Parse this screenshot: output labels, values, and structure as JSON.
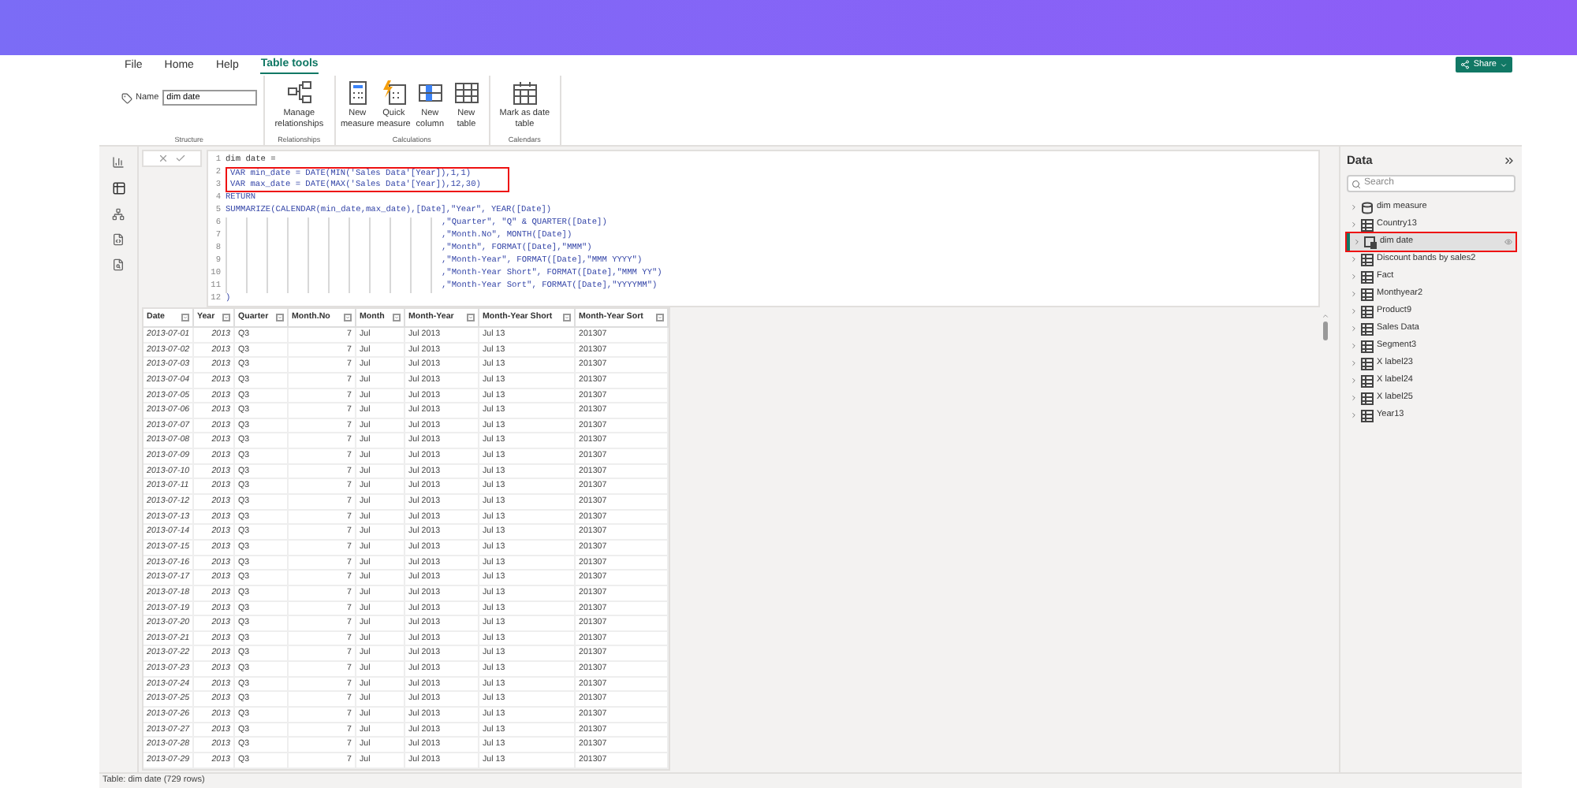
{
  "ribbon": {
    "tabs": [
      {
        "label": "File",
        "selected": false
      },
      {
        "label": "Home",
        "selected": false
      },
      {
        "label": "Help",
        "selected": false
      },
      {
        "label": "Table tools",
        "selected": true
      }
    ],
    "share": "Share",
    "name_label": "Name",
    "name_value": "dim date",
    "groups": [
      {
        "title": "Structure"
      },
      {
        "title": "Relationships",
        "buttons": [
          {
            "label": "Manage relationships",
            "kind": "relationships"
          }
        ]
      },
      {
        "title": "Calculations",
        "buttons": [
          {
            "label": "New measure",
            "kind": "measure"
          },
          {
            "label": "Quick measure",
            "kind": "quick"
          },
          {
            "label": "New column",
            "kind": "column"
          },
          {
            "label": "New table",
            "kind": "table"
          }
        ]
      },
      {
        "title": "Calendars",
        "buttons": [
          {
            "label": "Mark as date table",
            "kind": "calendar"
          }
        ]
      }
    ]
  },
  "formula": {
    "lines": [
      {
        "num": "1",
        "text": "dim date =",
        "kind": "statement",
        "highlighted": false
      },
      {
        "num": "2",
        "text": "VAR min_date = DATE(MIN('Sales Data'[Year]),1,1)",
        "kind": "statement",
        "highlighted": true
      },
      {
        "num": "3",
        "text": "VAR max_date = DATE(MAX('Sales Data'[Year]),12,30)",
        "kind": "statement",
        "highlighted": true
      },
      {
        "num": "4",
        "text": "RETURN",
        "kind": "statement",
        "highlighted": false
      },
      {
        "num": "5",
        "text": "SUMMARIZE(CALENDAR(min_date,max_date),[Date],\"Year\", YEAR([Date])",
        "kind": "statement",
        "highlighted": false
      },
      {
        "num": "6",
        "text": ",\"Quarter\", \"Q\" & QUARTER([Date])",
        "kind": "continuation",
        "highlighted": false
      },
      {
        "num": "7",
        "text": ",\"Month.No\", MONTH([Date])",
        "kind": "continuation",
        "highlighted": false
      },
      {
        "num": "8",
        "text": ",\"Month\", FORMAT([Date],\"MMM\")",
        "kind": "continuation",
        "highlighted": false
      },
      {
        "num": "9",
        "text": ",\"Month-Year\", FORMAT([Date],\"MMM YYYY\")",
        "kind": "continuation",
        "highlighted": false
      },
      {
        "num": "10",
        "text": ",\"Month-Year Short\", FORMAT([Date],\"MMM YY\")",
        "kind": "continuation",
        "highlighted": false
      },
      {
        "num": "11",
        "text": ",\"Month-Year Sort\", FORMAT([Date],\"YYYYMM\")",
        "kind": "continuation",
        "highlighted": false
      },
      {
        "num": "12",
        "text": ")",
        "kind": "statement",
        "highlighted": false
      }
    ]
  },
  "table": {
    "columns": [
      "Date",
      "Year",
      "Quarter",
      "Month.No",
      "Month",
      "Month-Year",
      "Month-Year Short",
      "Month-Year Sort"
    ],
    "rows": [
      [
        "2013-07-01",
        "2013",
        "Q3",
        "7",
        "Jul",
        "Jul 2013",
        "Jul 13",
        "201307"
      ],
      [
        "2013-07-02",
        "2013",
        "Q3",
        "7",
        "Jul",
        "Jul 2013",
        "Jul 13",
        "201307"
      ],
      [
        "2013-07-03",
        "2013",
        "Q3",
        "7",
        "Jul",
        "Jul 2013",
        "Jul 13",
        "201307"
      ],
      [
        "2013-07-04",
        "2013",
        "Q3",
        "7",
        "Jul",
        "Jul 2013",
        "Jul 13",
        "201307"
      ],
      [
        "2013-07-05",
        "2013",
        "Q3",
        "7",
        "Jul",
        "Jul 2013",
        "Jul 13",
        "201307"
      ],
      [
        "2013-07-06",
        "2013",
        "Q3",
        "7",
        "Jul",
        "Jul 2013",
        "Jul 13",
        "201307"
      ],
      [
        "2013-07-07",
        "2013",
        "Q3",
        "7",
        "Jul",
        "Jul 2013",
        "Jul 13",
        "201307"
      ],
      [
        "2013-07-08",
        "2013",
        "Q3",
        "7",
        "Jul",
        "Jul 2013",
        "Jul 13",
        "201307"
      ],
      [
        "2013-07-09",
        "2013",
        "Q3",
        "7",
        "Jul",
        "Jul 2013",
        "Jul 13",
        "201307"
      ],
      [
        "2013-07-10",
        "2013",
        "Q3",
        "7",
        "Jul",
        "Jul 2013",
        "Jul 13",
        "201307"
      ],
      [
        "2013-07-11",
        "2013",
        "Q3",
        "7",
        "Jul",
        "Jul 2013",
        "Jul 13",
        "201307"
      ],
      [
        "2013-07-12",
        "2013",
        "Q3",
        "7",
        "Jul",
        "Jul 2013",
        "Jul 13",
        "201307"
      ],
      [
        "2013-07-13",
        "2013",
        "Q3",
        "7",
        "Jul",
        "Jul 2013",
        "Jul 13",
        "201307"
      ],
      [
        "2013-07-14",
        "2013",
        "Q3",
        "7",
        "Jul",
        "Jul 2013",
        "Jul 13",
        "201307"
      ],
      [
        "2013-07-15",
        "2013",
        "Q3",
        "7",
        "Jul",
        "Jul 2013",
        "Jul 13",
        "201307"
      ],
      [
        "2013-07-16",
        "2013",
        "Q3",
        "7",
        "Jul",
        "Jul 2013",
        "Jul 13",
        "201307"
      ],
      [
        "2013-07-17",
        "2013",
        "Q3",
        "7",
        "Jul",
        "Jul 2013",
        "Jul 13",
        "201307"
      ],
      [
        "2013-07-18",
        "2013",
        "Q3",
        "7",
        "Jul",
        "Jul 2013",
        "Jul 13",
        "201307"
      ],
      [
        "2013-07-19",
        "2013",
        "Q3",
        "7",
        "Jul",
        "Jul 2013",
        "Jul 13",
        "201307"
      ],
      [
        "2013-07-20",
        "2013",
        "Q3",
        "7",
        "Jul",
        "Jul 2013",
        "Jul 13",
        "201307"
      ],
      [
        "2013-07-21",
        "2013",
        "Q3",
        "7",
        "Jul",
        "Jul 2013",
        "Jul 13",
        "201307"
      ],
      [
        "2013-07-22",
        "2013",
        "Q3",
        "7",
        "Jul",
        "Jul 2013",
        "Jul 13",
        "201307"
      ],
      [
        "2013-07-23",
        "2013",
        "Q3",
        "7",
        "Jul",
        "Jul 2013",
        "Jul 13",
        "201307"
      ],
      [
        "2013-07-24",
        "2013",
        "Q3",
        "7",
        "Jul",
        "Jul 2013",
        "Jul 13",
        "201307"
      ],
      [
        "2013-07-25",
        "2013",
        "Q3",
        "7",
        "Jul",
        "Jul 2013",
        "Jul 13",
        "201307"
      ],
      [
        "2013-07-26",
        "2013",
        "Q3",
        "7",
        "Jul",
        "Jul 2013",
        "Jul 13",
        "201307"
      ],
      [
        "2013-07-27",
        "2013",
        "Q3",
        "7",
        "Jul",
        "Jul 2013",
        "Jul 13",
        "201307"
      ],
      [
        "2013-07-28",
        "2013",
        "Q3",
        "7",
        "Jul",
        "Jul 2013",
        "Jul 13",
        "201307"
      ],
      [
        "2013-07-29",
        "2013",
        "Q3",
        "7",
        "Jul",
        "Jul 2013",
        "Jul 13",
        "201307"
      ]
    ]
  },
  "data_pane": {
    "title": "Data",
    "search": {
      "placeholder": "Search"
    },
    "items": [
      {
        "label": "dim measure",
        "kind": "measure",
        "selected": false
      },
      {
        "label": "Country13",
        "kind": "table",
        "selected": false
      },
      {
        "label": "dim date",
        "kind": "calculated",
        "selected": true
      },
      {
        "label": "Discount bands by sales2",
        "kind": "table",
        "selected": false
      },
      {
        "label": "Fact",
        "kind": "table",
        "selected": false
      },
      {
        "label": "Monthyear2",
        "kind": "table",
        "selected": false
      },
      {
        "label": "Product9",
        "kind": "table",
        "selected": false
      },
      {
        "label": "Sales Data",
        "kind": "table",
        "selected": false
      },
      {
        "label": "Segment3",
        "kind": "table",
        "selected": false
      },
      {
        "label": "X label23",
        "kind": "table",
        "selected": false
      },
      {
        "label": "X label24",
        "kind": "table",
        "selected": false
      },
      {
        "label": "X label25",
        "kind": "table",
        "selected": false
      },
      {
        "label": "Year13",
        "kind": "table",
        "selected": false
      }
    ]
  },
  "status_bar": "Table: dim date (729 rows)"
}
